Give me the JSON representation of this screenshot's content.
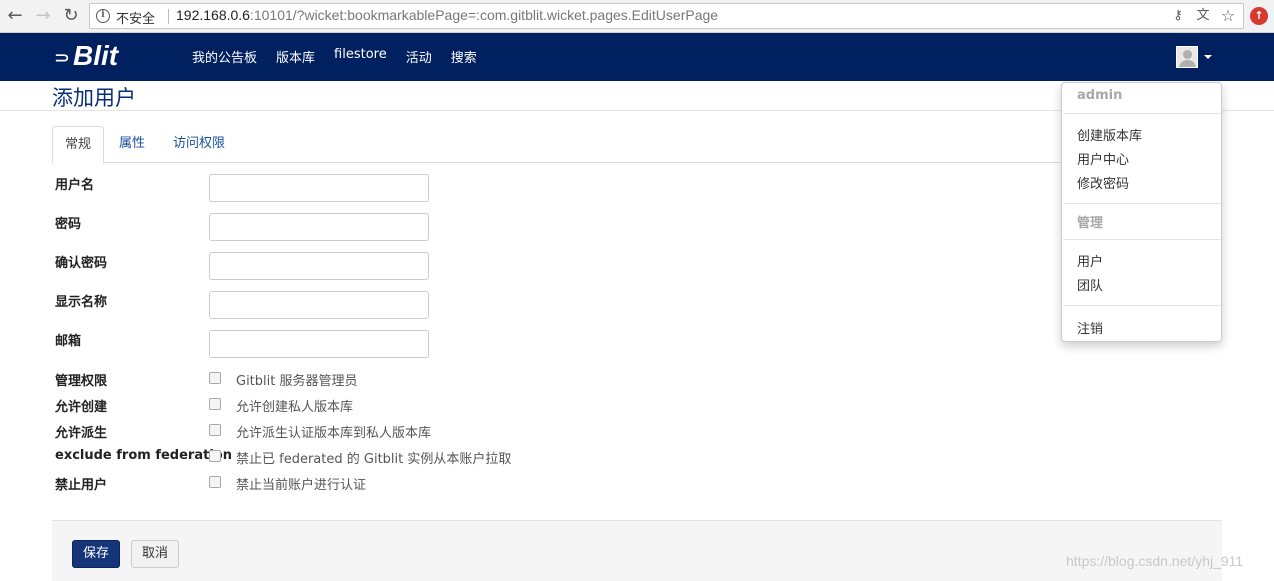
{
  "browser": {
    "back_icon": "arrow-left-icon",
    "forward_icon": "arrow-right-icon",
    "reload_icon": "reload-icon",
    "security_label": "不安全",
    "url_host": "192.168.0.6",
    "url_rest": ":10101/?wicket:bookmarkablePage=:com.gitblit.wicket.pages.EditUserPage"
  },
  "navbar": {
    "brand": "Blit",
    "links": [
      "我的公告板",
      "版本库",
      "filestore",
      "活动",
      "搜索"
    ],
    "bg_color": "#002060"
  },
  "page": {
    "title": "添加用户"
  },
  "tabs": [
    {
      "label": "常规",
      "active": true
    },
    {
      "label": "属性",
      "active": false
    },
    {
      "label": "访问权限",
      "active": false
    }
  ],
  "form": {
    "fields": [
      {
        "label": "用户名",
        "value": ""
      },
      {
        "label": "密码",
        "value": ""
      },
      {
        "label": "确认密码",
        "value": ""
      },
      {
        "label": "显示名称",
        "value": ""
      },
      {
        "label": "邮箱",
        "value": ""
      }
    ],
    "checkboxes": [
      {
        "label": "管理权限",
        "text": "Gitblit 服务器管理员",
        "checked": false
      },
      {
        "label": "允许创建",
        "text": "允许创建私人版本库",
        "checked": false
      },
      {
        "label": "允许派生",
        "text": "允许派生认证版本库到私人版本库",
        "checked": false
      },
      {
        "label": "exclude from federation",
        "text": "禁止已 federated 的 Gitblit 实例从本账户拉取",
        "checked": false
      },
      {
        "label": "禁止用户",
        "text": "禁止当前账户进行认证",
        "checked": false
      }
    ],
    "save_label": "保存",
    "cancel_label": "取消"
  },
  "user_menu": {
    "username": "admin",
    "items_1": [
      "创建版本库",
      "用户中心",
      "修改密码"
    ],
    "admin_header": "管理",
    "items_2": [
      "用户",
      "团队"
    ],
    "logout": "注销"
  },
  "watermark": "https://blog.csdn.net/yhj_911"
}
